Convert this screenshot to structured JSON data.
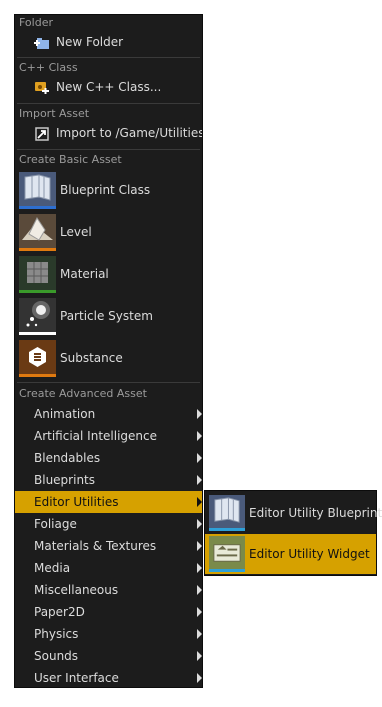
{
  "sections": {
    "folder": "Folder",
    "cpp": "C++ Class",
    "import": "Import Asset",
    "basic": "Create Basic Asset",
    "advanced": "Create Advanced Asset"
  },
  "items": {
    "new_folder": "New Folder",
    "new_cpp_class": "New C++ Class...",
    "import_to": "Import to /Game/Utilities..."
  },
  "basic_assets": [
    {
      "label": "Blueprint Class",
      "stripe": "#2d6ed0",
      "icon": "blueprint-icon"
    },
    {
      "label": "Level",
      "stripe": "#e07a10",
      "icon": "level-icon"
    },
    {
      "label": "Material",
      "stripe": "#3a9a2a",
      "icon": "material-icon"
    },
    {
      "label": "Particle System",
      "stripe": "#ffffff",
      "icon": "particle-system-icon"
    },
    {
      "label": "Substance",
      "stripe": "#e07a10",
      "icon": "substance-icon"
    }
  ],
  "advanced_assets": [
    "Animation",
    "Artificial Intelligence",
    "Blendables",
    "Blueprints",
    "Editor Utilities",
    "Foliage",
    "Materials & Textures",
    "Media",
    "Miscellaneous",
    "Paper2D",
    "Physics",
    "Sounds",
    "User Interface"
  ],
  "active_category": "Editor Utilities",
  "flyout": [
    {
      "label": "Editor Utility Blueprint",
      "icon": "editor-utility-blueprint-icon"
    },
    {
      "label": "Editor Utility Widget",
      "icon": "editor-utility-widget-icon"
    }
  ],
  "colors": {
    "accent": "#d6a100",
    "menu_bg": "#1c1c1c",
    "text": "#dcdcdc",
    "section_text": "#9b9b9b"
  }
}
